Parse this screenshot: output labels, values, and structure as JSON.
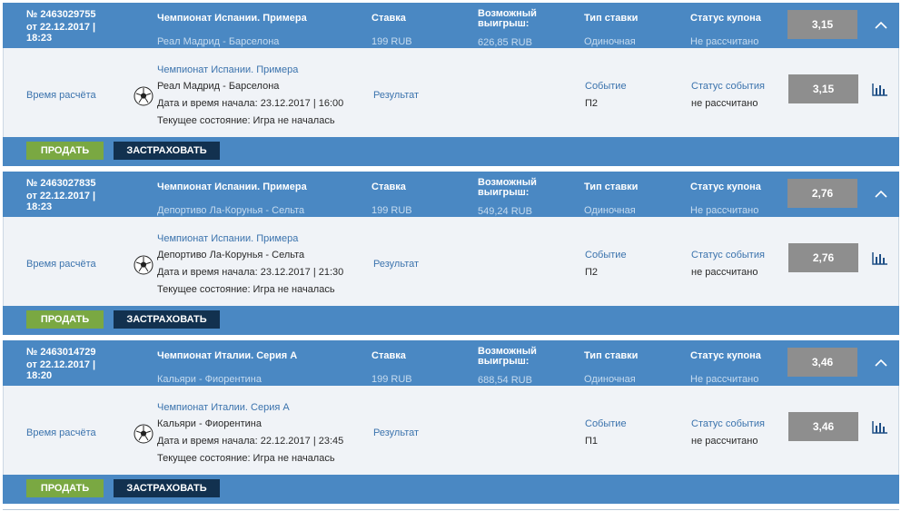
{
  "coupons": [
    {
      "number": "№ 2463029755",
      "date": "от 22.12.2017 | 18:23",
      "tournament": "Чемпионат Испании. Примера",
      "match": "Реал Мадрид - Барселона",
      "stake_label": "Ставка",
      "stake_value": "199 RUB",
      "win_label": "Возможный выигрыш:",
      "win_value": "626,85 RUB",
      "bet_type_label": "Тип ставки",
      "bet_type_value": "Одиночная",
      "coupon_status_label": "Статус купона",
      "coupon_status_value": "Не рассчитано",
      "odds": "3,15",
      "calc_time_label": "Время расчёта",
      "event_tournament": "Чемпионат Испании. Примера",
      "event_match": "Реал Мадрид - Барселона",
      "event_start": "Дата и время начала: 23.12.2017 | 16:00",
      "event_state": "Текущее состояние: Игра не началась",
      "result_label": "Результат",
      "event_label": "Событие",
      "event_outcome": "П2",
      "event_status_label": "Статус события",
      "event_status_value": "не рассчитано",
      "event_odds": "3,15",
      "sell_label": "ПРОДАТЬ",
      "insure_label": "ЗАСТРАХОВАТЬ"
    },
    {
      "number": "№ 2463027835",
      "date": "от 22.12.2017 | 18:23",
      "tournament": "Чемпионат Испании. Примера",
      "match": "Депортиво Ла-Корунья - Сельта",
      "stake_label": "Ставка",
      "stake_value": "199 RUB",
      "win_label": "Возможный выигрыш:",
      "win_value": "549,24 RUB",
      "bet_type_label": "Тип ставки",
      "bet_type_value": "Одиночная",
      "coupon_status_label": "Статус купона",
      "coupon_status_value": "Не рассчитано",
      "odds": "2,76",
      "calc_time_label": "Время расчёта",
      "event_tournament": "Чемпионат Испании. Примера",
      "event_match": "Депортиво Ла-Корунья - Сельта",
      "event_start": "Дата и время начала: 23.12.2017 | 21:30",
      "event_state": "Текущее состояние: Игра не началась",
      "result_label": "Результат",
      "event_label": "Событие",
      "event_outcome": "П2",
      "event_status_label": "Статус события",
      "event_status_value": "не рассчитано",
      "event_odds": "2,76",
      "sell_label": "ПРОДАТЬ",
      "insure_label": "ЗАСТРАХОВАТЬ"
    },
    {
      "number": "№ 2463014729",
      "date": "от 22.12.2017 | 18:20",
      "tournament": "Чемпионат Италии. Серия А",
      "match": "Кальяри - Фиорентина",
      "stake_label": "Ставка",
      "stake_value": "199 RUB",
      "win_label": "Возможный выигрыш:",
      "win_value": "688,54 RUB",
      "bet_type_label": "Тип ставки",
      "bet_type_value": "Одиночная",
      "coupon_status_label": "Статус купона",
      "coupon_status_value": "Не рассчитано",
      "odds": "3,46",
      "calc_time_label": "Время расчёта",
      "event_tournament": "Чемпионат Италии. Серия А",
      "event_match": "Кальяри - Фиорентина",
      "event_start": "Дата и время начала: 22.12.2017 | 23:45",
      "event_state": "Текущее состояние: Игра не началась",
      "result_label": "Результат",
      "event_label": "Событие",
      "event_outcome": "П1",
      "event_status_label": "Статус события",
      "event_status_value": "не рассчитано",
      "event_odds": "3,46",
      "sell_label": "ПРОДАТЬ",
      "insure_label": "ЗАСТРАХОВАТЬ"
    }
  ],
  "icons": {
    "expand": "chevron-up-icon",
    "sport": "soccer-ball-icon",
    "stats": "bar-chart-icon"
  },
  "colors": {
    "header_bg": "#4a88c3",
    "body_bg": "#f0f3f7",
    "odds_bg": "#8e8e8e",
    "sell_bg": "#7aa842",
    "insure_bg": "#12314f",
    "link": "#3b73ad"
  }
}
